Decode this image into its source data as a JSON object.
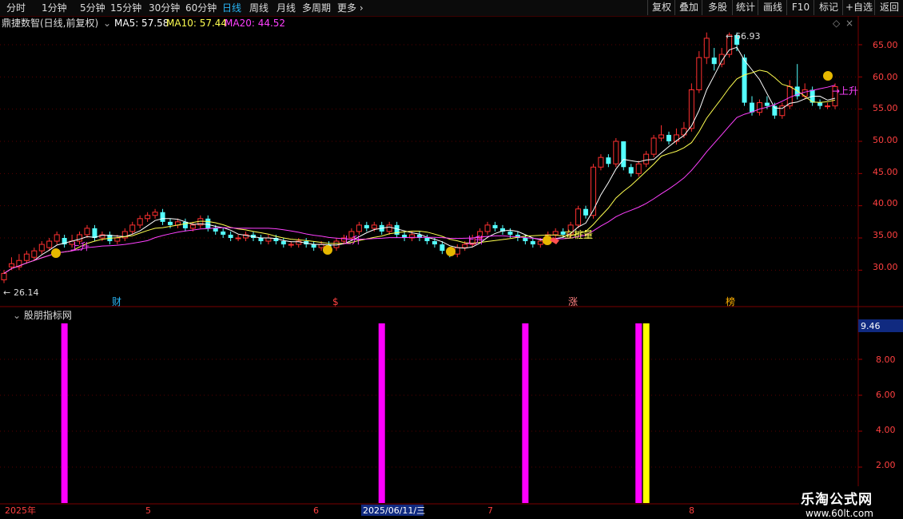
{
  "toolbar": {
    "items": [
      "分时",
      "1分钟",
      "5分钟",
      "15分钟",
      "30分钟",
      "60分钟",
      "日线",
      "周线",
      "月线",
      "多周期",
      "更多"
    ],
    "active": "日线",
    "right": [
      "复权",
      "叠加",
      "多股",
      "统计",
      "画线",
      "F10",
      "标记",
      "+自选",
      "返回"
    ]
  },
  "main": {
    "title": "鼎捷数智(日线,前复权)",
    "ma5": "MA5: 57.58",
    "ma10": "MA10: 57.44",
    "ma20": "MA20: 44.52",
    "high_label": "66.93",
    "low_label": "26.14",
    "price_axis": [
      "65.00",
      "60.00",
      "55.00",
      "50.00",
      "45.00",
      "40.00",
      "35.00",
      "30.00"
    ],
    "annotations": [
      "上升",
      "上升",
      "上升",
      "上升",
      "立桩量",
      "上升"
    ],
    "event_markers": [
      "财",
      "$",
      "涨",
      "榜"
    ]
  },
  "sub": {
    "title": "股朋指标网",
    "current_value": "9.46",
    "axis": [
      "8.00",
      "6.00",
      "4.00",
      "2.00"
    ]
  },
  "date_axis": {
    "labels": [
      "2025年",
      "5",
      "6",
      "7",
      "8"
    ],
    "cursor": "2025/06/11/三"
  },
  "watermark": {
    "title": "乐淘公式网",
    "url": "www.60lt.com"
  },
  "colors": {
    "up": "#ff3030",
    "down": "#54ffff",
    "ma5": "#ffffff",
    "ma10": "#ffff50",
    "ma20": "#ff40ff",
    "accent": "#29b6f6"
  },
  "chart_data": [
    {
      "type": "candlestick",
      "title": "鼎捷数智(日线,前复权)",
      "ylim": [
        27,
        68
      ],
      "series_ma": [
        {
          "name": "MA5",
          "value": 57.58
        },
        {
          "name": "MA10",
          "value": 57.44
        },
        {
          "name": "MA20",
          "value": 44.52
        }
      ],
      "candles": [
        [
          28.5,
          29.5,
          28.0,
          30.0
        ],
        [
          30.5,
          31.0,
          30.0,
          32.0
        ],
        [
          30.5,
          31.5,
          30.0,
          32.5
        ],
        [
          31.5,
          32.5,
          31.0,
          33.0
        ],
        [
          32.0,
          33.0,
          31.5,
          33.5
        ],
        [
          33.0,
          34.0,
          32.5,
          34.5
        ],
        [
          33.5,
          34.5,
          33.0,
          35.0
        ],
        [
          34.5,
          35.5,
          34.0,
          36.0
        ],
        [
          35.0,
          34.0,
          33.5,
          35.5
        ],
        [
          34.0,
          34.5,
          33.5,
          35.5
        ],
        [
          34.5,
          35.5,
          34.0,
          36.0
        ],
        [
          35.5,
          36.5,
          35.0,
          37.0
        ],
        [
          36.5,
          35.0,
          34.5,
          37.0
        ],
        [
          35.0,
          35.5,
          34.5,
          36.0
        ],
        [
          35.5,
          34.5,
          34.0,
          36.0
        ],
        [
          34.5,
          35.0,
          34.0,
          35.5
        ],
        [
          35.0,
          36.0,
          34.5,
          36.5
        ],
        [
          36.0,
          37.0,
          35.5,
          37.5
        ],
        [
          37.0,
          38.0,
          36.5,
          38.5
        ],
        [
          38.0,
          38.5,
          37.5,
          39.0
        ],
        [
          38.5,
          39.0,
          38.0,
          39.5
        ],
        [
          39.0,
          37.5,
          37.0,
          39.5
        ],
        [
          37.5,
          37.0,
          36.5,
          38.0
        ],
        [
          37.0,
          37.5,
          36.5,
          38.0
        ],
        [
          37.5,
          36.5,
          36.0,
          38.0
        ],
        [
          36.5,
          37.0,
          36.0,
          37.5
        ],
        [
          37.0,
          38.0,
          36.5,
          38.5
        ],
        [
          38.0,
          36.5,
          36.0,
          38.5
        ],
        [
          36.5,
          36.0,
          35.5,
          37.0
        ],
        [
          36.0,
          35.5,
          35.0,
          36.5
        ],
        [
          35.5,
          35.0,
          34.5,
          36.0
        ],
        [
          35.0,
          35.0,
          34.5,
          35.5
        ],
        [
          35.0,
          35.5,
          34.5,
          36.0
        ],
        [
          35.5,
          35.0,
          34.5,
          36.0
        ],
        [
          35.0,
          34.5,
          34.0,
          35.5
        ],
        [
          34.5,
          35.0,
          34.0,
          35.5
        ],
        [
          35.0,
          34.5,
          34.0,
          35.5
        ],
        [
          34.5,
          34.0,
          33.5,
          35.0
        ],
        [
          34.0,
          34.0,
          33.5,
          34.5
        ],
        [
          34.0,
          34.5,
          33.5,
          35.0
        ],
        [
          34.5,
          34.0,
          33.5,
          35.0
        ],
        [
          34.0,
          33.5,
          33.0,
          34.5
        ],
        [
          33.5,
          34.0,
          33.0,
          34.5
        ],
        [
          34.0,
          33.5,
          33.0,
          34.5
        ],
        [
          33.5,
          34.5,
          33.0,
          35.0
        ],
        [
          34.5,
          35.0,
          34.0,
          35.5
        ],
        [
          35.0,
          36.0,
          34.5,
          36.5
        ],
        [
          36.0,
          37.0,
          35.5,
          37.5
        ],
        [
          37.0,
          36.5,
          36.0,
          37.5
        ],
        [
          36.5,
          37.0,
          36.0,
          37.5
        ],
        [
          37.0,
          36.0,
          35.5,
          37.5
        ],
        [
          36.0,
          37.0,
          35.5,
          37.5
        ],
        [
          37.0,
          35.5,
          35.0,
          37.5
        ],
        [
          35.5,
          35.0,
          34.5,
          36.0
        ],
        [
          35.0,
          35.5,
          34.5,
          36.0
        ],
        [
          35.5,
          35.0,
          34.5,
          36.0
        ],
        [
          35.0,
          34.5,
          34.0,
          35.5
        ],
        [
          34.5,
          34.0,
          33.5,
          35.0
        ],
        [
          34.0,
          33.0,
          32.5,
          34.5
        ],
        [
          33.0,
          32.5,
          32.0,
          33.5
        ],
        [
          32.5,
          33.5,
          32.0,
          34.0
        ],
        [
          33.5,
          34.0,
          33.0,
          34.5
        ],
        [
          34.0,
          35.0,
          33.5,
          35.5
        ],
        [
          35.0,
          36.0,
          34.5,
          36.5
        ],
        [
          36.0,
          37.0,
          35.5,
          37.5
        ],
        [
          37.0,
          36.5,
          36.0,
          37.5
        ],
        [
          36.5,
          36.0,
          35.5,
          37.0
        ],
        [
          36.0,
          35.5,
          35.0,
          36.5
        ],
        [
          35.5,
          35.0,
          34.5,
          36.0
        ],
        [
          35.0,
          34.5,
          34.0,
          35.5
        ],
        [
          34.5,
          34.0,
          33.5,
          35.0
        ],
        [
          34.0,
          34.5,
          33.5,
          35.0
        ],
        [
          34.5,
          35.5,
          34.0,
          36.0
        ],
        [
          35.5,
          36.0,
          35.0,
          36.5
        ],
        [
          36.0,
          35.5,
          35.0,
          36.5
        ],
        [
          35.5,
          37.0,
          35.0,
          37.5
        ],
        [
          37.0,
          39.5,
          36.5,
          40.0
        ],
        [
          39.5,
          38.5,
          38.0,
          40.0
        ],
        [
          38.5,
          46.0,
          38.0,
          46.5
        ],
        [
          46.0,
          47.5,
          45.5,
          48.0
        ],
        [
          47.5,
          46.5,
          46.0,
          48.0
        ],
        [
          46.5,
          50.0,
          46.0,
          50.5
        ],
        [
          50.0,
          46.0,
          45.5,
          50.0
        ],
        [
          46.0,
          45.0,
          44.5,
          46.5
        ],
        [
          45.0,
          46.5,
          44.5,
          47.0
        ],
        [
          46.5,
          48.0,
          46.0,
          48.5
        ],
        [
          48.0,
          50.5,
          47.5,
          51.0
        ],
        [
          50.5,
          51.0,
          50.0,
          52.5
        ],
        [
          51.0,
          50.0,
          49.5,
          51.5
        ],
        [
          50.0,
          51.0,
          49.5,
          52.0
        ],
        [
          51.0,
          52.0,
          50.5,
          53.0
        ],
        [
          52.0,
          58.0,
          51.5,
          59.0
        ],
        [
          58.0,
          63.0,
          57.5,
          64.0
        ],
        [
          63.0,
          66.0,
          62.0,
          66.9
        ],
        [
          63.0,
          62.0,
          61.0,
          64.5
        ],
        [
          62.0,
          63.5,
          61.5,
          64.5
        ],
        [
          63.5,
          66.5,
          63.0,
          66.9
        ],
        [
          66.5,
          65.0,
          64.0,
          66.9
        ],
        [
          63.0,
          56.0,
          55.5,
          63.5
        ],
        [
          56.0,
          54.5,
          54.0,
          57.0
        ],
        [
          54.5,
          56.0,
          54.0,
          56.5
        ],
        [
          56.0,
          55.5,
          55.0,
          57.0
        ],
        [
          55.5,
          54.0,
          53.5,
          56.0
        ],
        [
          54.0,
          55.5,
          53.5,
          56.0
        ],
        [
          55.5,
          58.5,
          55.0,
          59.5
        ],
        [
          58.5,
          57.0,
          56.5,
          62.0
        ],
        [
          57.0,
          58.0,
          56.5,
          59.0
        ],
        [
          58.0,
          56.0,
          55.5,
          58.5
        ],
        [
          56.0,
          55.5,
          55.0,
          56.5
        ],
        [
          55.5,
          55.5,
          55.0,
          56.0
        ],
        [
          55.5,
          58.5,
          55.0,
          59.0
        ]
      ]
    },
    {
      "type": "bar",
      "title": "股朋指标网",
      "ylim": [
        0,
        10
      ],
      "bars": [
        {
          "index": 8,
          "value": 10,
          "color": "magenta"
        },
        {
          "index": 50,
          "value": 10,
          "color": "magenta"
        },
        {
          "index": 69,
          "value": 10,
          "color": "magenta"
        },
        {
          "index": 84,
          "value": 10,
          "color": "magenta"
        },
        {
          "index": 85,
          "value": 10,
          "color": "yellow"
        },
        {
          "index": 127,
          "value": 9.46,
          "color": "magenta"
        }
      ]
    }
  ]
}
